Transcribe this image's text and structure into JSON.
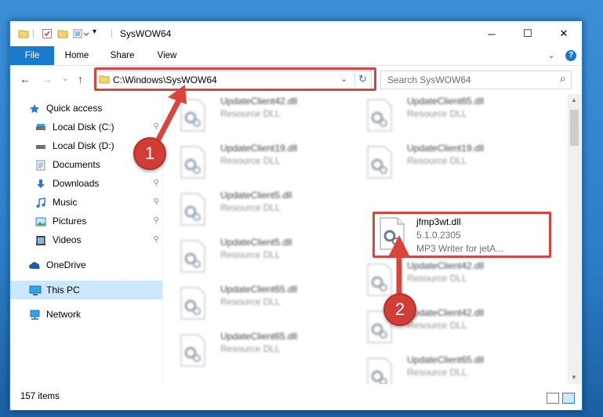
{
  "window": {
    "title": "SysWOW64",
    "controls": {
      "minimize": "─",
      "maximize": "☐",
      "close": "✕"
    }
  },
  "ribbon": {
    "tabs": [
      "File",
      "Home",
      "Share",
      "View"
    ],
    "collapse_glyph": "⌄",
    "help_glyph": "?"
  },
  "navbar": {
    "back": "←",
    "forward": "→",
    "recent": "⌄",
    "up": "↑",
    "address": "C:\\Windows\\SysWOW64",
    "address_dropdown": "⌄",
    "refresh": "↻",
    "search_placeholder": "Search SysWOW64",
    "search_glyph": "⌕"
  },
  "sidebar": {
    "items": [
      {
        "label": "Quick access",
        "icon": "star-icon",
        "pinned": false
      },
      {
        "label": "Local Disk (C:)",
        "icon": "drive-icon",
        "pinned": true
      },
      {
        "label": "Local Disk (D:)",
        "icon": "drive-icon",
        "pinned": true
      },
      {
        "label": "Documents",
        "icon": "documents-icon",
        "pinned": true
      },
      {
        "label": "Downloads",
        "icon": "downloads-icon",
        "pinned": true
      },
      {
        "label": "Music",
        "icon": "music-icon",
        "pinned": true
      },
      {
        "label": "Pictures",
        "icon": "pictures-icon",
        "pinned": true
      },
      {
        "label": "Videos",
        "icon": "videos-icon",
        "pinned": true
      },
      {
        "label": "OneDrive",
        "icon": "onedrive-icon",
        "pinned": false
      },
      {
        "label": "This PC",
        "icon": "this-pc-icon",
        "pinned": false,
        "selected": true
      },
      {
        "label": "Network",
        "icon": "network-icon",
        "pinned": false
      }
    ],
    "pin_glyph": "📌"
  },
  "files": {
    "left": [
      {
        "name": "UpdateClient42.dll",
        "type": "Resource DLL"
      },
      {
        "name": "UpdateClient19.dll",
        "type": "Resource DLL"
      },
      {
        "name": "UpdateClient5.dll",
        "type": "Resource DLL"
      },
      {
        "name": "UpdateClient5.dll",
        "type": "Resource DLL"
      },
      {
        "name": "UpdateClient65.dll",
        "type": "Resource DLL"
      },
      {
        "name": "UpdateClient65.dll",
        "type": "Resource DLL"
      }
    ],
    "right": [
      {
        "name": "UpdateClient65.dll",
        "type": "Resource DLL"
      },
      {
        "name": "UpdateClient19.dll",
        "type": "Resource DLL"
      },
      {
        "name": "UpdateClient42.dll",
        "type": "Resource DLL"
      },
      {
        "name": "UpdateClient42.dll",
        "type": "Resource DLL"
      },
      {
        "name": "UpdateClient65.dll",
        "type": "Resource DLL"
      }
    ],
    "featured": {
      "name": "jfmp3wt.dll",
      "version": "5.1.0.2305",
      "description": "MP3 Writer for jetA..."
    }
  },
  "status": {
    "item_count": "157 items"
  },
  "callouts": [
    {
      "number": "1"
    },
    {
      "number": "2"
    }
  ],
  "colors": {
    "accent": "#1979ca",
    "highlight": "#d9453c",
    "selected": "#cce8ff",
    "folder": "#f7d36b"
  }
}
